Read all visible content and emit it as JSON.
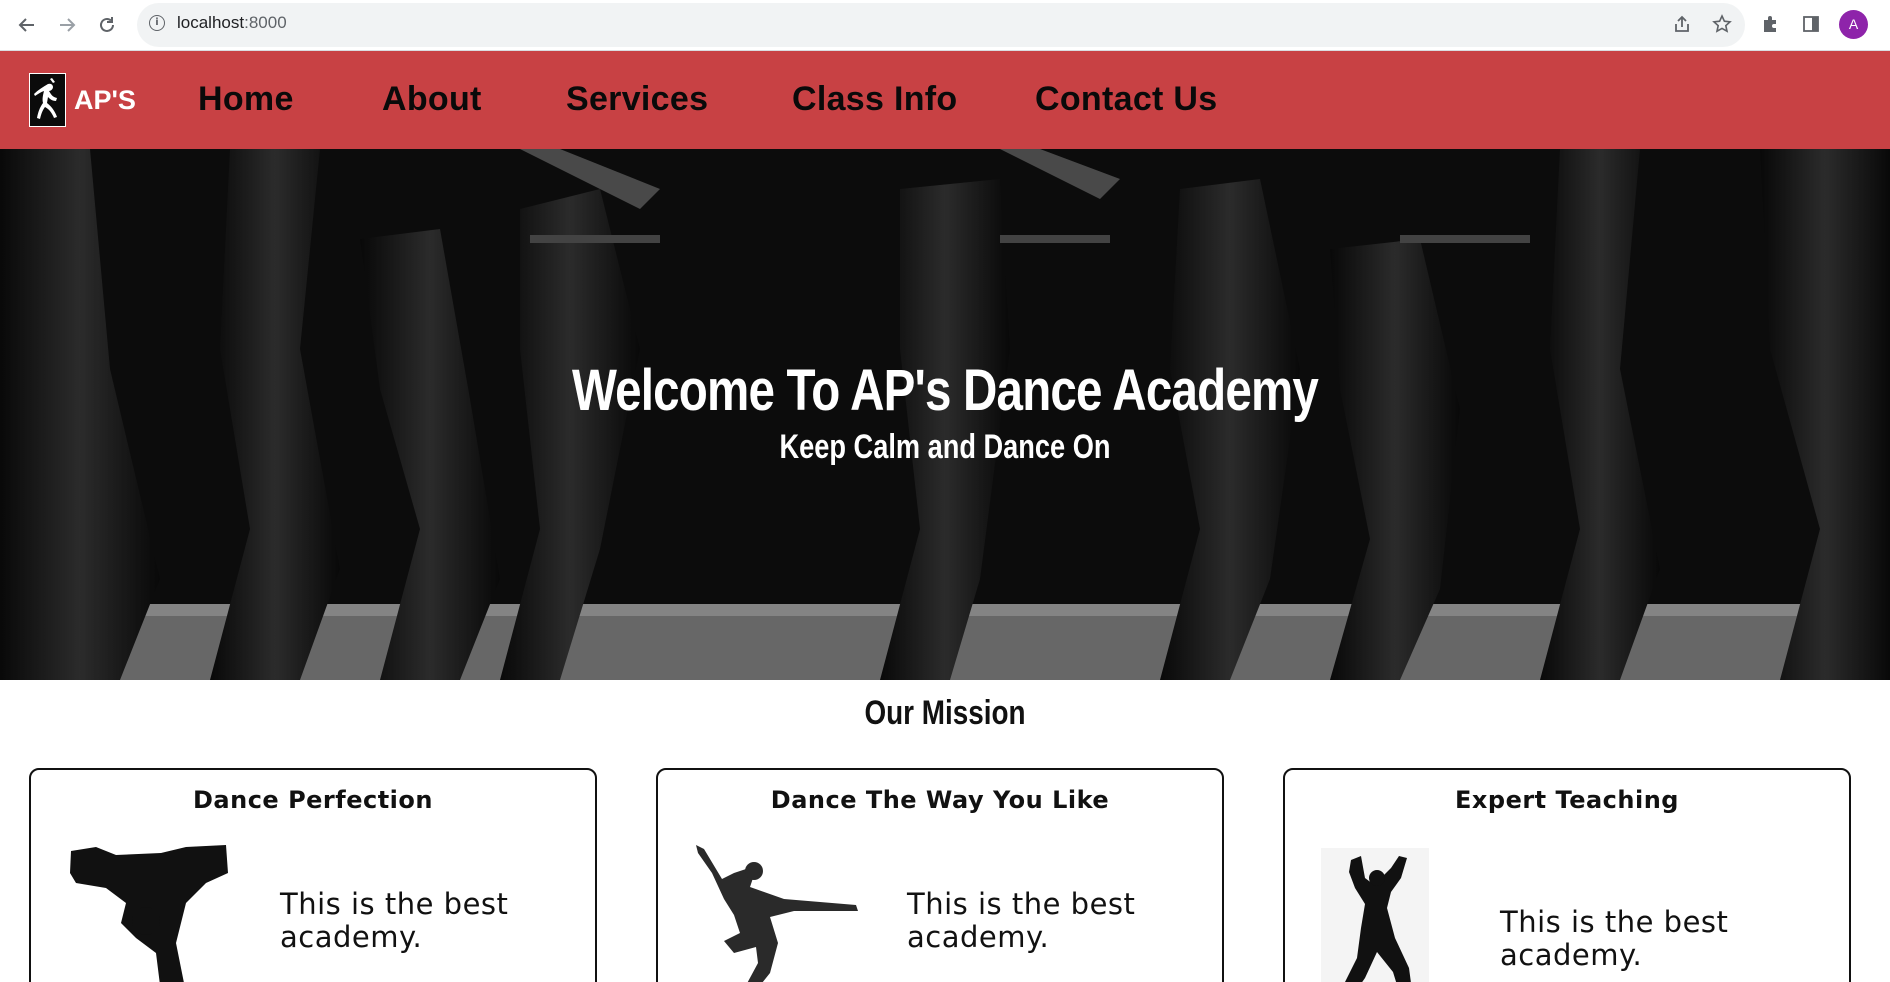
{
  "browser": {
    "url_host": "localhost",
    "url_port": ":8000",
    "avatar_letter": "A",
    "icons": [
      "back-arrow-icon",
      "forward-arrow-icon",
      "reload-icon",
      "site-info-icon",
      "share-icon",
      "bookmark-star-icon",
      "extensions-puzzle-icon",
      "side-panel-icon"
    ]
  },
  "nav": {
    "logo_text": "AP'S",
    "links": [
      "Home",
      "About",
      "Services",
      "Class Info",
      "Contact Us"
    ],
    "bg_color": "#c84144"
  },
  "hero": {
    "title": "Welcome To AP's Dance Academy",
    "subtitle": "Keep Calm and Dance On"
  },
  "mission": {
    "title": "Our Mission",
    "cards": [
      {
        "title": "Dance Perfection",
        "text": "This is the best academy.",
        "image": "breakdancer-silhouette"
      },
      {
        "title": "Dance The Way You Like",
        "text": "This is the best academy.",
        "image": "leaping-dancer-silhouette"
      },
      {
        "title": "Expert Teaching",
        "text": "This is the best academy.",
        "image": "posing-dancer-silhouette"
      }
    ]
  }
}
